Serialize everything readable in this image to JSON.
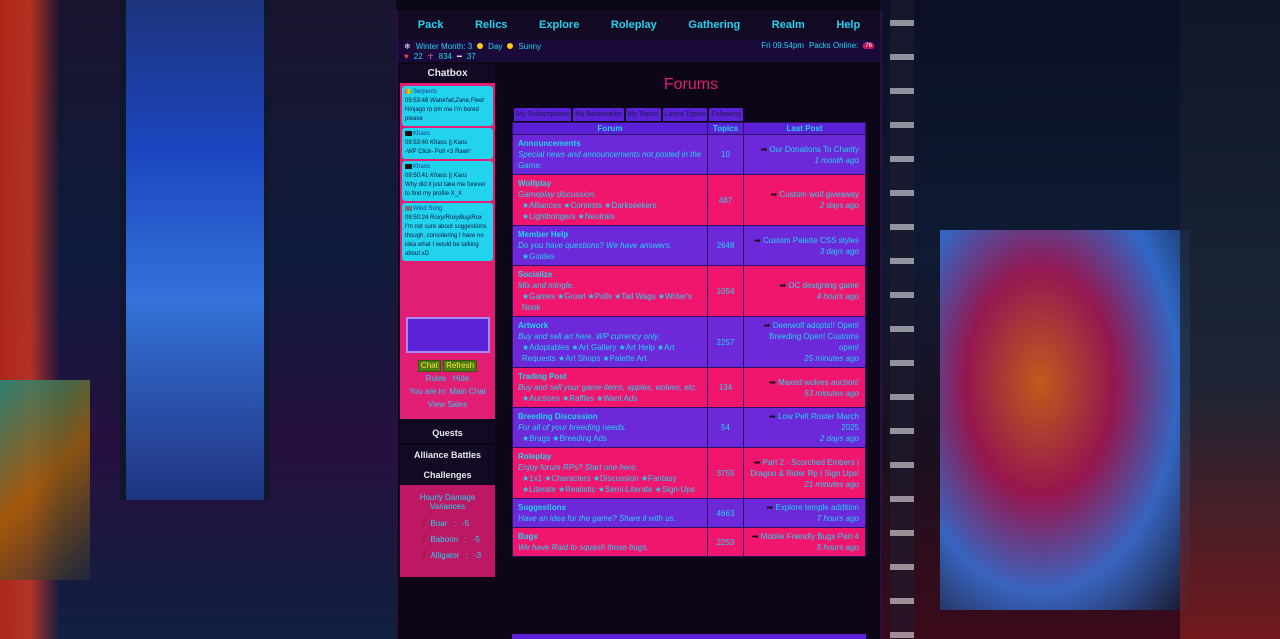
{
  "nav": [
    "Pack",
    "Relics",
    "Explore",
    "Roleplay",
    "Gathering",
    "Realm",
    "Help"
  ],
  "status": {
    "season": "Winter Month: 3",
    "time_of_day": "Day",
    "weather": "Sunny",
    "hearts": "22",
    "ankh": "834",
    "bones": "37",
    "clock": "Fri 09:54pm",
    "packs_online_label": "Packs Online:",
    "packs_online": "76"
  },
  "chatbox": {
    "title": "Chatbox",
    "messages": [
      {
        "user": "Serpents",
        "time": "09:53:48",
        "speaker": "Waterfall,Zane,Fleet",
        "text": "Ninjago rp pm me I'm bored please",
        "flag": "rainbow"
      },
      {
        "user": "Khaos",
        "time": "09:53:40",
        "speaker": "Khaos || Kaos",
        "text": "-WP Click- Poll <3 Rawr!",
        "flag": "black"
      },
      {
        "user": "Khaos",
        "time": "09:50:41",
        "speaker": "Khaos || Kaos",
        "text": "Why did it just take me forever to find my profile X_X",
        "flag": "black"
      },
      {
        "user": "Wind Song",
        "time": "09:50:24",
        "speaker": "Roxy/RoxyBug/Rox",
        "text": "I'm not sure about suggestions though, considering I have no idea what I would be talking about xD",
        "flag": "gray"
      }
    ],
    "chat_btn": "Chat",
    "refresh_btn": "Refresh",
    "rules": "Rules",
    "hide": "Hide",
    "location": "You are in: Main Chat",
    "view_sales": "View Sales"
  },
  "side": {
    "quests": "Quests",
    "alliance": "Alliance Battles",
    "challenges": "Challenges",
    "variances_title": "Hourly Damage Variances",
    "enemies": [
      {
        "name": "Boar",
        "value": "-5"
      },
      {
        "name": "Baboon",
        "value": "-5"
      },
      {
        "name": "Alligator",
        "value": "-3"
      }
    ]
  },
  "forums": {
    "title": "Forums",
    "tabs": [
      "My Subscriptions",
      "My Bookmarks",
      "My Topics",
      "Latest Topics",
      "Following"
    ],
    "headers": [
      "Forum",
      "Topics",
      "Last Post"
    ],
    "rows": [
      {
        "name": "Announcements",
        "desc": "Special news and announcements not posted in the Game.",
        "subs": "",
        "topics": "10",
        "last": "Our Donations To Charity",
        "ago": "1 month ago",
        "color": "purple"
      },
      {
        "name": "Wolfplay",
        "desc": "Gameplay discussion.",
        "subs": "★Alliances ★Contests ★Darkseekers ★Lightbringers ★Neutrals",
        "topics": "487",
        "last": "Custom wolf giveaway",
        "ago": "2 days ago",
        "color": "pink"
      },
      {
        "name": "Member Help",
        "desc": "Do you have questions? We have answers.",
        "subs": "★Guides",
        "topics": "2648",
        "last": "Custom Palette CSS styles",
        "ago": "3 days ago",
        "color": "purple"
      },
      {
        "name": "Socialize",
        "desc": "Mix and mingle.",
        "subs": "★Games ★Growl ★Polls ★Tail Wags ★Writer's Nook",
        "topics": "1054",
        "last": "OC designing game",
        "ago": "4 hours ago",
        "color": "pink"
      },
      {
        "name": "Artwork",
        "desc": "Buy and sell art here. WP currency only.",
        "subs": "★Adoptables ★Art Gallery ★Art Help ★Art Requests ★Art Shops ★Palette Art",
        "topics": "2257",
        "last": "Deerwolf adopts!! Open! Breeding Open! Customs open!",
        "ago": "25 minutes ago",
        "color": "purple"
      },
      {
        "name": "Trading Post",
        "desc": "Buy and sell your game items, apples, wolves, etc.",
        "subs": "★Auctions ★Raffles ★Want Ads",
        "topics": "134",
        "last": "Maxed wolves auction!",
        "ago": "53 minutes ago",
        "color": "pink"
      },
      {
        "name": "Breeding Discussion",
        "desc": "For all of your breeding needs.",
        "subs": "★Brags ★Breeding Ads",
        "topics": "54",
        "last": "Low Pelt Roster March 2025",
        "ago": "2 days ago",
        "color": "purple"
      },
      {
        "name": "Roleplay",
        "desc": "Enjoy forum RPs? Start one here.",
        "subs": "★1x1 ★Characters ★Discussion ★Fantasy ★Literate ★Realistic ★Semi-Literate ★Sign-Ups",
        "topics": "3755",
        "last": "Part 2 - Scorched Embers | Dragon & Rider Rp | Sign Ups!",
        "ago": "21 minutes ago",
        "color": "pink"
      },
      {
        "name": "Suggestions",
        "desc": "Have an idea for the game? Share it with us.",
        "subs": "",
        "topics": "4663",
        "last": "Explore temple addition",
        "ago": "7 hours ago",
        "color": "purple"
      },
      {
        "name": "Bugs",
        "desc": "We have Raid to squash those bugs.",
        "subs": "",
        "topics": "2253",
        "last": "Mobile Friendly Bugs Part 4",
        "ago": "5 hours ago",
        "color": "pink"
      }
    ]
  }
}
